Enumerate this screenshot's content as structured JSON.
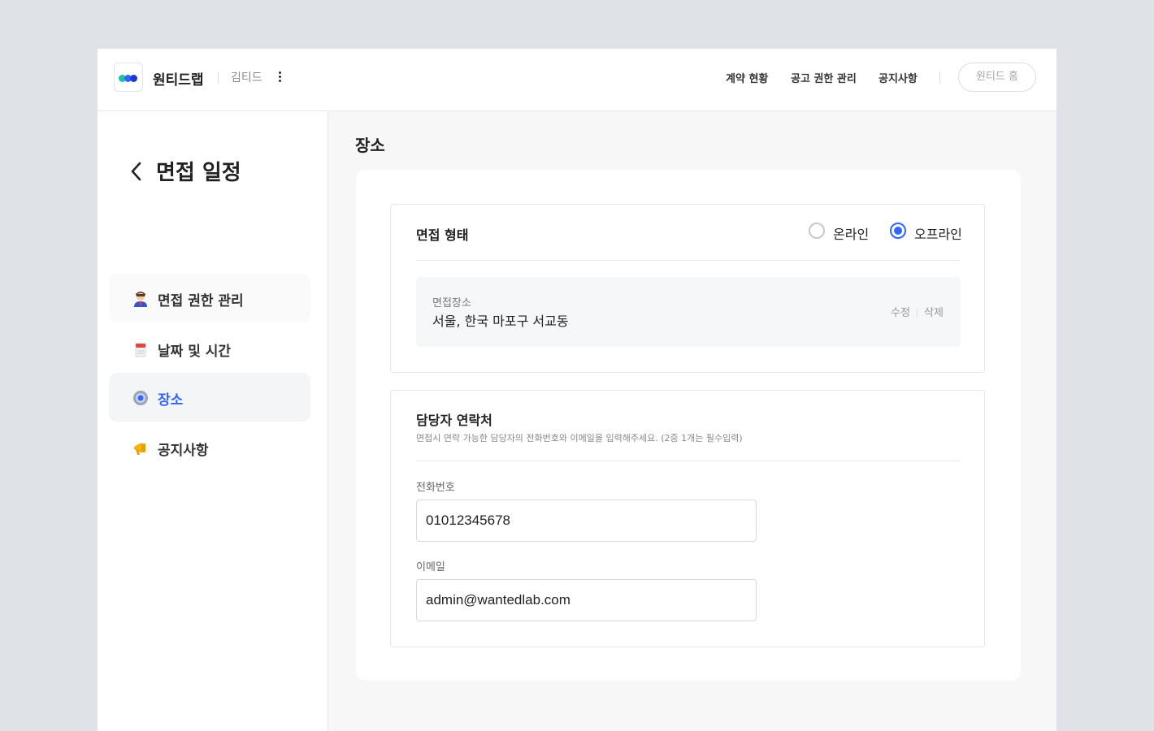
{
  "header": {
    "company": "원티드랩",
    "user": "김티드",
    "nav": [
      "계약 현황",
      "공고 권한 관리",
      "공지사항"
    ],
    "home_button": "원티드 홈"
  },
  "sidebar": {
    "title": "면접 일정",
    "items": [
      {
        "label": "면접 권한 관리",
        "icon": "person-emoji-icon"
      },
      {
        "label": "날짜 및 시간",
        "icon": "calendar-emoji-icon"
      },
      {
        "label": "장소",
        "icon": "location-pin-emoji-icon",
        "active": true
      },
      {
        "label": "공지사항",
        "icon": "megaphone-emoji-icon"
      }
    ]
  },
  "main": {
    "title": "장소",
    "interview_type": {
      "title": "면접 형태",
      "options": [
        "온라인",
        "오프라인"
      ],
      "selected": "오프라인"
    },
    "place": {
      "label": "면접장소",
      "value": "서울, 한국 마포구 서교동",
      "edit": "수정",
      "delete": "삭제"
    },
    "contact": {
      "title": "담당자 연락처",
      "description": "면접시 연락 가능한 담당자의 전화번호와 이메일을 입력해주세요. (2중 1개는 필수입력)",
      "phone_label": "전화번호",
      "phone_value": "01012345678",
      "email_label": "이메일",
      "email_value": "admin@wantedlab.com"
    }
  },
  "colors": {
    "accent": "#3366ff",
    "background": "#dfe2e6"
  }
}
